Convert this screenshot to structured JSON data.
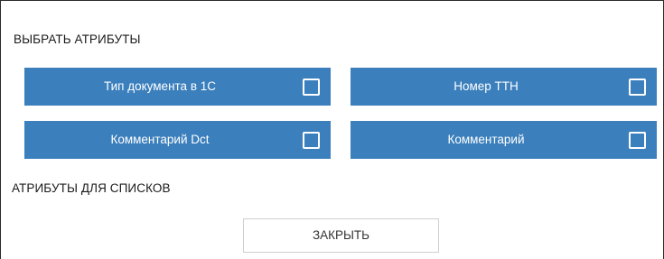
{
  "dialog": {
    "select_title": "ВЫБРАТЬ АТРИБУТЫ",
    "attributes": [
      {
        "label": "Тип документа в 1С",
        "checked": false
      },
      {
        "label": "Номер ТТН",
        "checked": false
      },
      {
        "label": "Комментарий Dct",
        "checked": false
      },
      {
        "label": "Комментарий",
        "checked": false
      }
    ],
    "lists_title": "АТРИБУТЫ ДЛЯ СПИСКОВ",
    "close_label": "ЗАКРЫТЬ"
  },
  "colors": {
    "button_bg": "#3b7fbd",
    "button_text": "#ffffff",
    "border": "#2b2b2b"
  },
  "icons": {
    "checkbox": "checkbox-unchecked-icon"
  }
}
